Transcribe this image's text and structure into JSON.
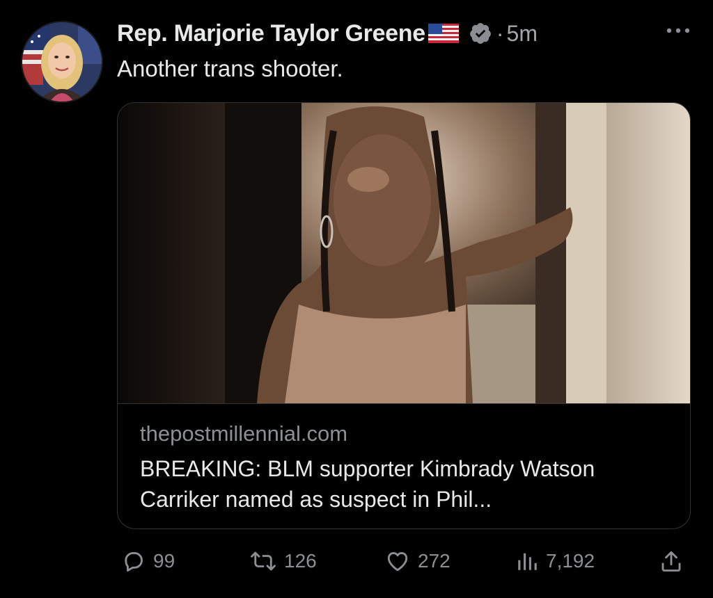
{
  "post": {
    "author_name": "Rep. Marjorie Taylor Greene",
    "separator": "·",
    "timestamp": "5m",
    "text": "Another trans shooter."
  },
  "link_card": {
    "domain": "thepostmillennial.com",
    "title": "BREAKING: BLM supporter Kimbrady Watson Carriker named as suspect in Phil..."
  },
  "actions": {
    "replies": "99",
    "reposts": "126",
    "likes": "272",
    "views": "7,192"
  },
  "icons": {
    "avatar": "profile-photo",
    "flag": "us-flag-emoji",
    "verified": "verified-badge-icon",
    "more": "more-options-icon",
    "reply": "reply-icon",
    "repost": "repost-icon",
    "like": "heart-icon",
    "views": "views-icon",
    "share": "share-icon"
  },
  "colors": {
    "background": "#000000",
    "primary_text": "#e7e9ea",
    "secondary_text": "#8b9094",
    "border": "#2f3336",
    "verified_badge": "#8a8d91"
  }
}
